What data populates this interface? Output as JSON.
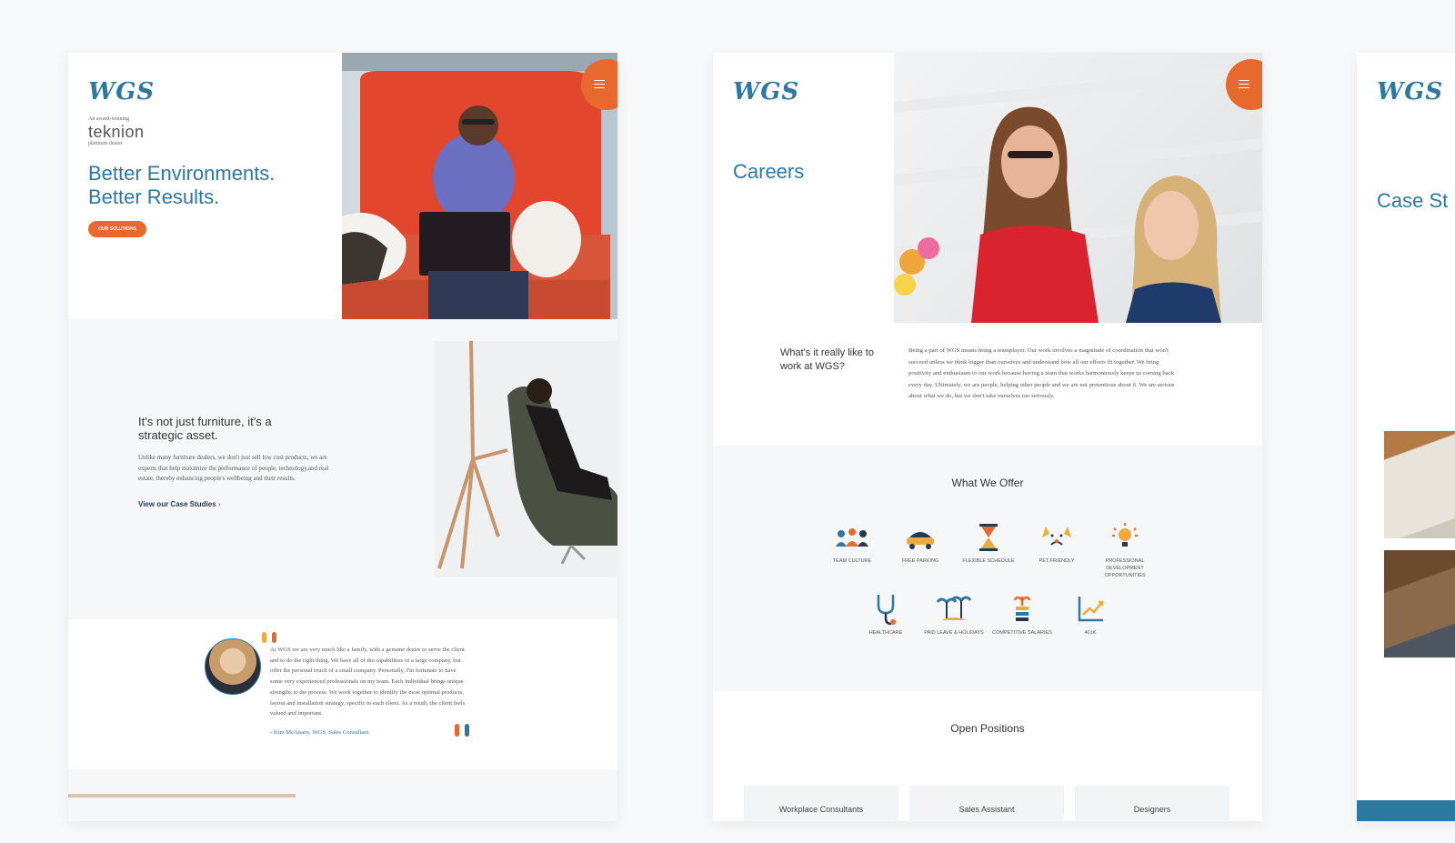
{
  "colors": {
    "brand_blue": "#2d78a0",
    "accent_orange": "#e8692e",
    "bg": "#f7f8f9"
  },
  "home": {
    "logo": "WGS",
    "tag_small_top": "An award-winning",
    "tag_brand": "teknion",
    "tag_small_bottom": "platinum dealer",
    "hero_line1": "Better Environments.",
    "hero_line2": "Better Results.",
    "hero_button": "OUR SOLUTIONS",
    "menu_icon": "hamburger-icon",
    "section_heading": "It's not just furniture, it's a strategic asset.",
    "section_body": "Unlike many furniture dealers, we don't just sell low cost products, we are experts that help maximize the performance of people, technology,and real estate, thereby enhancing people's wellbeing and their results.",
    "case_link": "View our Case Studies",
    "quote": "At WGS we are very much like a family, with a genuine desire to serve the client and to do the right thing. We have all of the capabilities of a large company, but offer the personal touch of a small company. Personally, I'm fortunate to have some very experienced professionals on my team. Each individual brings unique strengths to the process. We work together to identify the most optimal products, layout and installation strategy, specific to each client. As a result, the client feels valued and important.",
    "quote_author": "- Kim McAnany, WGS, Sales Consultant"
  },
  "careers": {
    "logo": "WGS",
    "title": "Careers",
    "intro_question": "What's it really like to work at WGS?",
    "intro_body": "Being a part of WGS means being a teamplayer. Our work involves a magnitude of coordination that won't succeed unless we think bigger than ourselves and understand how all our efforts fit together. We bring positivity and enthusiasm to our work because having a team that works harmoniously keeps us coming back every day. Ultimately, we are people, helping other people and we are not pretentious about it. We are serious about what we do, but we don't take ourselves too seriously.",
    "offer_heading": "What We Offer",
    "offers": [
      {
        "label": "TEAM CULTURE",
        "icon": "team-icon"
      },
      {
        "label": "FREE PARKING",
        "icon": "car-icon"
      },
      {
        "label": "FLEXIBLE SCHEDULE",
        "icon": "hourglass-icon"
      },
      {
        "label": "PET FRIENDLY",
        "icon": "dog-icon"
      },
      {
        "label": "PROFESSIONAL DEVELOPMENT OPPORTUNITIES",
        "icon": "lightbulb-icon"
      },
      {
        "label": "HEALTHCARE",
        "icon": "stethoscope-icon"
      },
      {
        "label": "PAID LEAVE & HOLIDAYS",
        "icon": "palm-tree-icon"
      },
      {
        "label": "COMPETITIVE SALARIES",
        "icon": "plant-coins-icon"
      },
      {
        "label": "401K",
        "icon": "chart-icon"
      }
    ],
    "positions_heading": "Open Positions",
    "positions": [
      "Workplace Consultants",
      "Sales Assistant",
      "Designers"
    ]
  },
  "casestudies": {
    "logo": "WGS",
    "title": "Case St"
  }
}
